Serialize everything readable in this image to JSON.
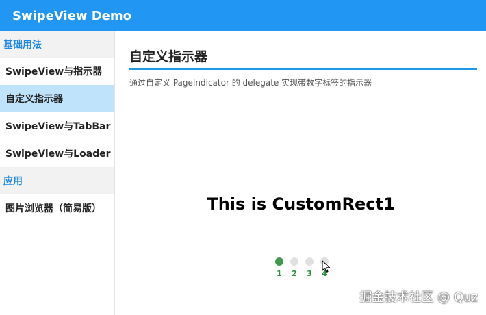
{
  "app": {
    "title": "SwipeView Demo"
  },
  "sidebar": {
    "groups": [
      {
        "header": "基础用法",
        "items": [
          {
            "label": "SwipeView与指示器",
            "active": false
          },
          {
            "label": "自定义指示器",
            "active": true
          },
          {
            "label": "SwipeView与TabBar",
            "active": false
          },
          {
            "label": "SwipeView与Loader",
            "active": false
          }
        ]
      },
      {
        "header": "应用",
        "items": [
          {
            "label": "图片浏览器（简易版）",
            "active": false
          }
        ]
      }
    ]
  },
  "main": {
    "title": "自定义指示器",
    "description": "通过自定义 PageIndicator 的 delegate 实现带数字标签的指示器",
    "slide_text": "This is CustomRect1",
    "indicator": {
      "current_page": 1,
      "labels": [
        "1",
        "2",
        "3",
        "4"
      ]
    }
  },
  "watermark": "掘金技术社区 @ Quz",
  "colors": {
    "topbar": "#2196f3",
    "group_header_text": "#1e88e5",
    "active_item_bg": "#bfe3fb",
    "indicator_active": "#3d9a4f",
    "indicator_inactive": "#e0e0e0",
    "title_rule": "#1e9be8"
  }
}
